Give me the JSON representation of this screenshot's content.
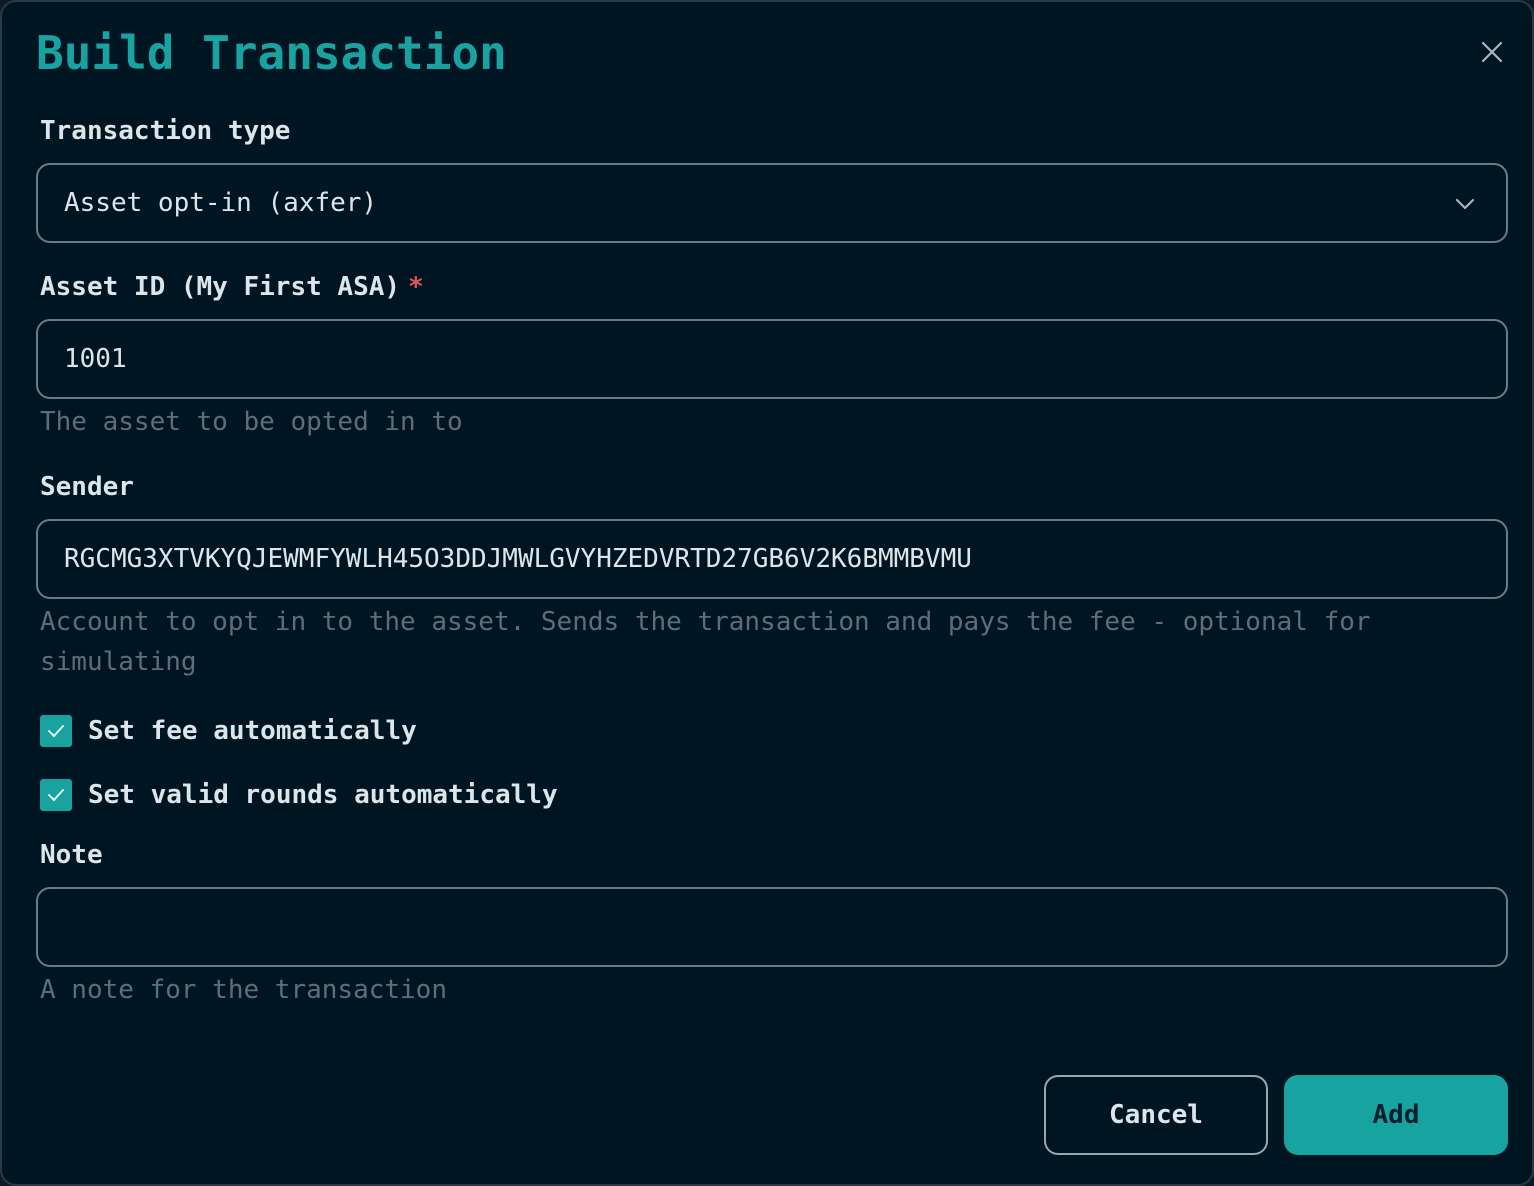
{
  "dialog": {
    "title": "Build Transaction"
  },
  "transaction_type": {
    "label": "Transaction type",
    "selected": "Asset opt-in (axfer)"
  },
  "asset_id": {
    "label": "Asset ID (My First ASA)",
    "required_mark": "*",
    "value": "1001",
    "help": "The asset to be opted in to"
  },
  "sender": {
    "label": "Sender",
    "value": "RGCMG3XTVKYQJEWMFYWLH45O3DDJMWLGVYHZEDVRTD27GB6V2K6BMMBVMU",
    "help": "Account to opt in to the asset. Sends the transaction and pays the fee - optional for simulating"
  },
  "options": {
    "set_fee_label": "Set fee automatically",
    "set_fee_checked": true,
    "set_rounds_label": "Set valid rounds automatically",
    "set_rounds_checked": true
  },
  "note": {
    "label": "Note",
    "value": "",
    "help": "A note for the transaction"
  },
  "buttons": {
    "cancel": "Cancel",
    "add": "Add"
  },
  "colors": {
    "accent": "#18a3a1",
    "background": "#001522",
    "required": "#e0525c"
  },
  "icons": {
    "close": "close-icon",
    "dropdown": "chevron-down-icon",
    "check": "check-icon"
  }
}
